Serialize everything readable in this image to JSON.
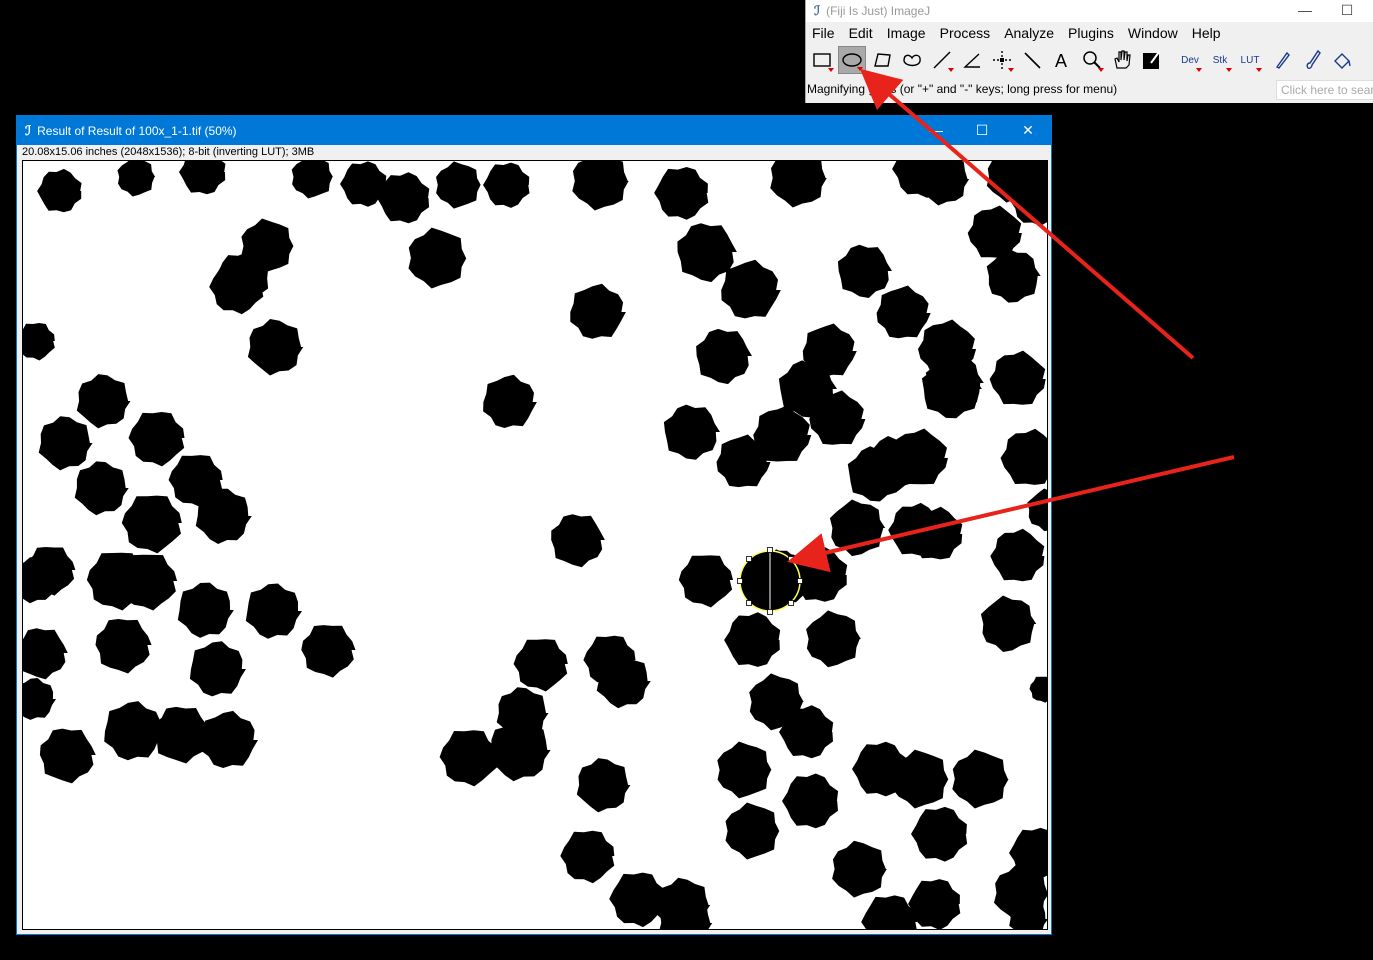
{
  "main_window": {
    "title": "(Fiji Is Just) ImageJ",
    "logo": "fiji-logo",
    "menus": [
      "File",
      "Edit",
      "Image",
      "Process",
      "Analyze",
      "Plugins",
      "Window",
      "Help"
    ],
    "tools": [
      {
        "name": "rectangle-tool-icon",
        "icon": "rectangle",
        "menu": true
      },
      {
        "name": "oval-tool-icon",
        "icon": "oval",
        "menu": true,
        "selected": true
      },
      {
        "name": "polygon-tool-icon",
        "icon": "polygon",
        "menu": false
      },
      {
        "name": "freehand-tool-icon",
        "icon": "freehand",
        "menu": false
      },
      {
        "name": "line-tool-icon",
        "icon": "line",
        "menu": true
      },
      {
        "name": "angle-tool-icon",
        "icon": "angle",
        "menu": false
      },
      {
        "name": "point-tool-icon",
        "icon": "point",
        "menu": true
      },
      {
        "name": "wand-tool-icon",
        "icon": "wand",
        "menu": false
      },
      {
        "name": "text-tool-icon",
        "icon": "text",
        "menu": false
      },
      {
        "name": "magnifier-tool-icon",
        "icon": "magnifier",
        "menu": true
      },
      {
        "name": "hand-tool-icon",
        "icon": "hand",
        "menu": false
      },
      {
        "name": "color-picker-tool-icon",
        "icon": "picker",
        "menu": false
      },
      {
        "name": "dev-tool-icon",
        "label": "Dev",
        "menu": true
      },
      {
        "name": "stk-tool-icon",
        "label": "Stk",
        "menu": true
      },
      {
        "name": "lut-tool-icon",
        "label": "LUT",
        "menu": true
      },
      {
        "name": "pencil-tool-icon",
        "icon": "pencil",
        "menu": false
      },
      {
        "name": "brush-tool-icon",
        "icon": "brush",
        "menu": false
      },
      {
        "name": "flood-fill-tool-icon",
        "icon": "flood",
        "menu": false
      }
    ],
    "status_text": "Magnifying glass (or \"+\" and \"-\" keys; long press for menu)",
    "search_placeholder": "Click here to search"
  },
  "image_window": {
    "title": "Result of Result of 100x_1-1.tif (50%)",
    "info": "20.08x15.06 inches (2048x1536); 8-bit (inverting LUT); 3MB"
  },
  "colors": {
    "accent_titlebar": "#0078d7",
    "blob": "#000000",
    "background": "#ffffff",
    "annotation_arrow": "#e8231b",
    "selection_outline": "#ffff60"
  }
}
